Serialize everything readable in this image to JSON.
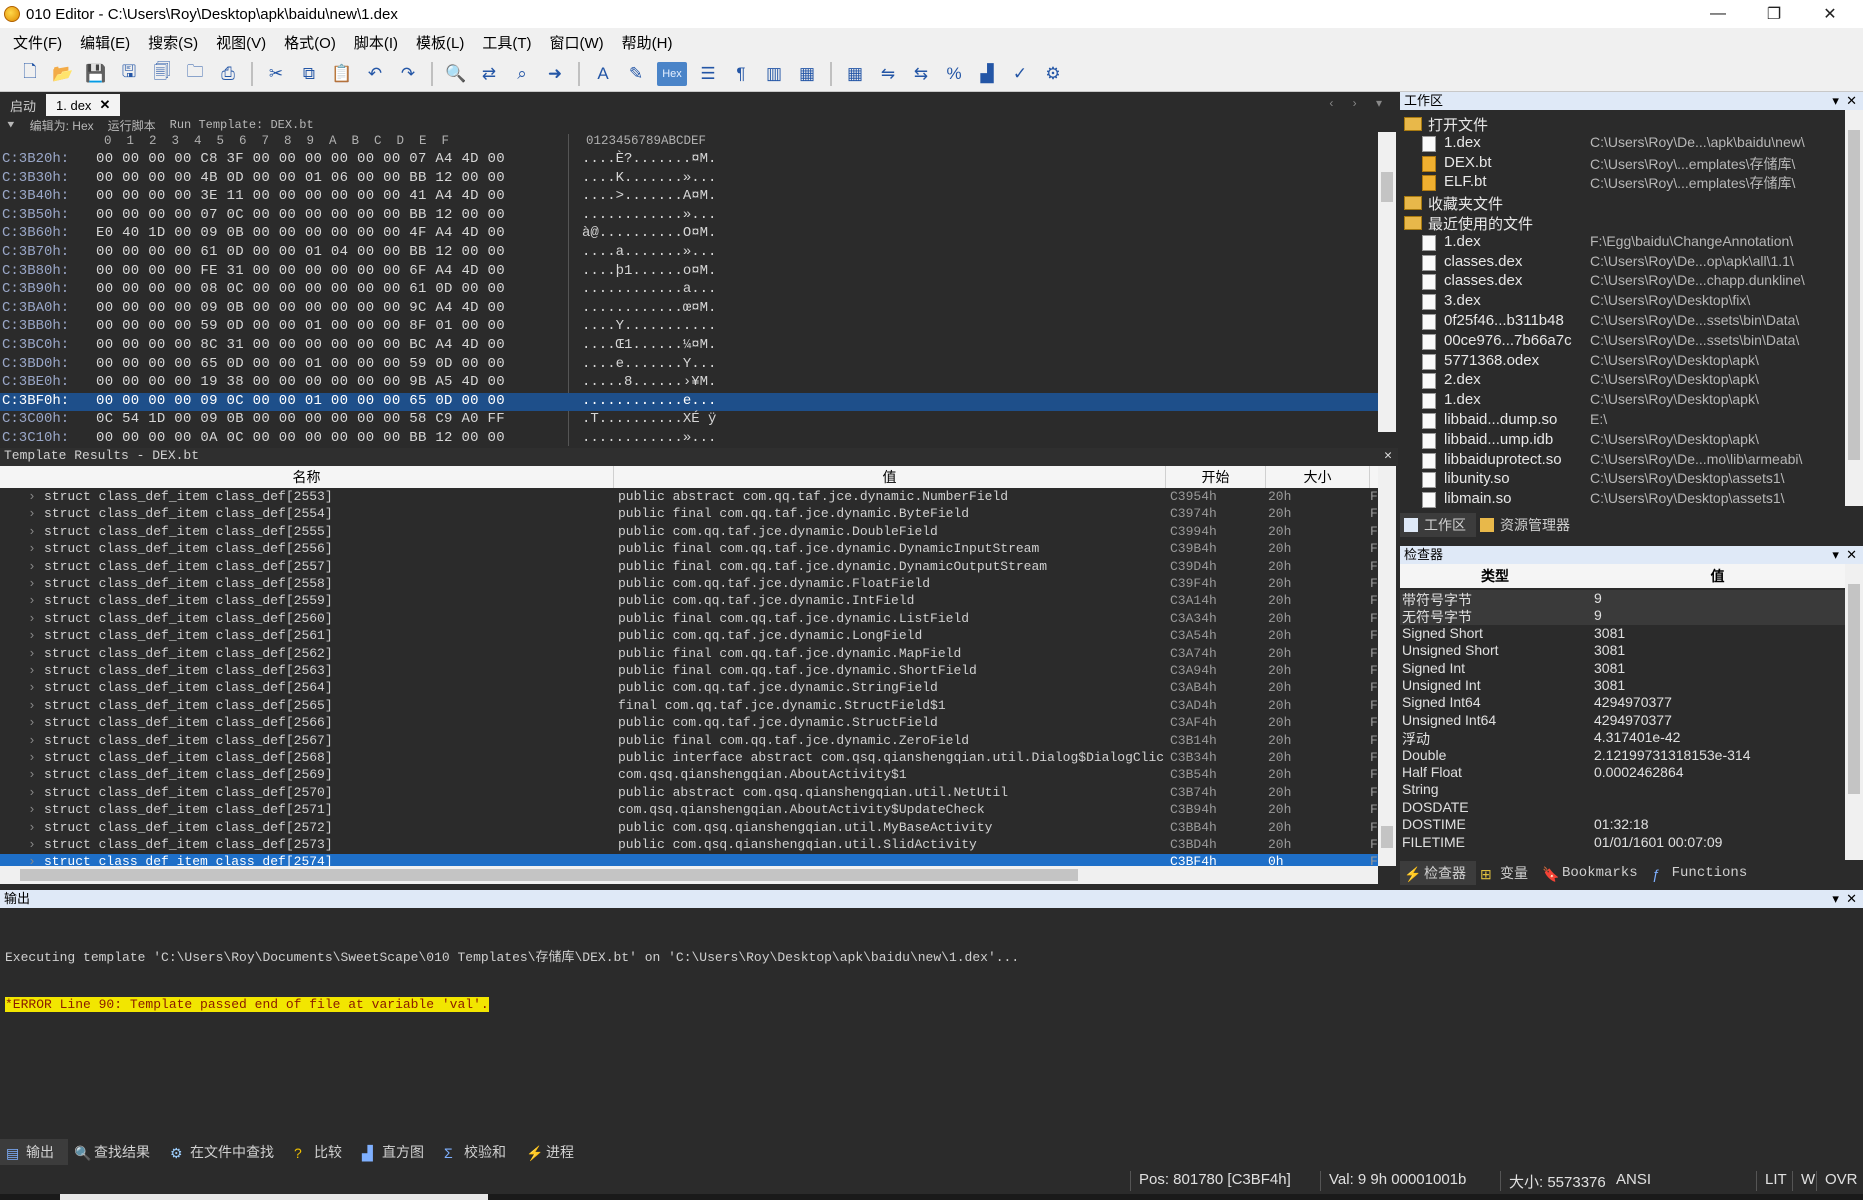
{
  "window": {
    "title": "010 Editor - C:\\Users\\Roy\\Desktop\\apk\\baidu\\new\\1.dex"
  },
  "menu": [
    "文件(F)",
    "编辑(E)",
    "搜索(S)",
    "视图(V)",
    "格式(O)",
    "脚本(I)",
    "模板(L)",
    "工具(T)",
    "窗口(W)",
    "帮助(H)"
  ],
  "tabs": {
    "start": "启动",
    "active": "1. dex"
  },
  "hex": {
    "edit_as": "编辑为: Hex",
    "run_script": "运行脚本",
    "run_template": "Run Template: DEX.bt",
    "col_header": "0  1  2  3  4  5  6  7  8  9  A  B  C  D  E  F",
    "ascii_header": "0123456789ABCDEF",
    "rows": [
      {
        "addr": "C:3B20h:",
        "bytes": "00 00 00 00 C8 3F 00 00 00 00 00 00 07 A4 4D 00",
        "ascii": "....È?.......¤M."
      },
      {
        "addr": "C:3B30h:",
        "bytes": "00 00 00 00 4B 0D 00 00 01 06 00 00 BB 12 00 00",
        "ascii": "....K.......»..."
      },
      {
        "addr": "C:3B40h:",
        "bytes": "00 00 00 00 3E 11 00 00 00 00 00 00 41 A4 4D 00",
        "ascii": "....>.......A¤M."
      },
      {
        "addr": "C:3B50h:",
        "bytes": "00 00 00 00 07 0C 00 00 00 00 00 00 BB 12 00 00",
        "ascii": "............»..."
      },
      {
        "addr": "C:3B60h:",
        "bytes": "E0 40 1D 00 09 0B 00 00 00 00 00 00 4F A4 4D 00",
        "ascii": "à@..........O¤M."
      },
      {
        "addr": "C:3B70h:",
        "bytes": "00 00 00 00 61 0D 00 00 01 04 00 00 BB 12 00 00",
        "ascii": "....a.......»..."
      },
      {
        "addr": "C:3B80h:",
        "bytes": "00 00 00 00 FE 31 00 00 00 00 00 00 6F A4 4D 00",
        "ascii": "....þ1......o¤M."
      },
      {
        "addr": "C:3B90h:",
        "bytes": "00 00 00 00 08 0C 00 00 00 00 00 00 61 0D 00 00",
        "ascii": "............a..."
      },
      {
        "addr": "C:3BA0h:",
        "bytes": "00 00 00 00 09 0B 00 00 00 00 00 00 9C A4 4D 00",
        "ascii": "............œ¤M."
      },
      {
        "addr": "C:3BB0h:",
        "bytes": "00 00 00 00 59 0D 00 00 01 00 00 00 8F 01 00 00",
        "ascii": "....Y..........."
      },
      {
        "addr": "C:3BC0h:",
        "bytes": "00 00 00 00 8C 31 00 00 00 00 00 00 BC A4 4D 00",
        "ascii": "....Œ1......¼¤M."
      },
      {
        "addr": "C:3BD0h:",
        "bytes": "00 00 00 00 65 0D 00 00 01 00 00 00 59 0D 00 00",
        "ascii": "....e.......Y..."
      },
      {
        "addr": "C:3BE0h:",
        "bytes": "00 00 00 00 19 38 00 00 00 00 00 00 9B A5 4D 00",
        "ascii": ".....8......›¥M."
      },
      {
        "addr": "C:3BF0h:",
        "bytes": "00 00 00 00 09 0C 00 00 01 00 00 00 65 0D 00 00",
        "ascii": "............e..."
      },
      {
        "addr": "C:3C00h:",
        "bytes": "0C 54 1D 00 09 0B 00 00 00 00 00 00 58 C9 A0 FF",
        "ascii": ".T..........XÉ ÿ"
      },
      {
        "addr": "C:3C10h:",
        "bytes": "00 00 00 00 0A 0C 00 00 00 00 00 00 BB 12 00 00",
        "ascii": "............»..."
      }
    ]
  },
  "template": {
    "title": "Template Results - DEX.bt",
    "columns": {
      "name": "名称",
      "value": "值",
      "start": "开始",
      "size": "大小"
    },
    "rows": [
      {
        "name": "struct class_def_item class_def[2553]",
        "value": "public abstract com.qq.taf.jce.dynamic.NumberField",
        "start": "C3954h",
        "size": "20h"
      },
      {
        "name": "struct class_def_item class_def[2554]",
        "value": "public final com.qq.taf.jce.dynamic.ByteField",
        "start": "C3974h",
        "size": "20h"
      },
      {
        "name": "struct class_def_item class_def[2555]",
        "value": "public com.qq.taf.jce.dynamic.DoubleField",
        "start": "C3994h",
        "size": "20h"
      },
      {
        "name": "struct class_def_item class_def[2556]",
        "value": "public final com.qq.taf.jce.dynamic.DynamicInputStream",
        "start": "C39B4h",
        "size": "20h"
      },
      {
        "name": "struct class_def_item class_def[2557]",
        "value": "public final com.qq.taf.jce.dynamic.DynamicOutputStream",
        "start": "C39D4h",
        "size": "20h"
      },
      {
        "name": "struct class_def_item class_def[2558]",
        "value": "public com.qq.taf.jce.dynamic.FloatField",
        "start": "C39F4h",
        "size": "20h"
      },
      {
        "name": "struct class_def_item class_def[2559]",
        "value": "public com.qq.taf.jce.dynamic.IntField",
        "start": "C3A14h",
        "size": "20h"
      },
      {
        "name": "struct class_def_item class_def[2560]",
        "value": "public final com.qq.taf.jce.dynamic.ListField",
        "start": "C3A34h",
        "size": "20h"
      },
      {
        "name": "struct class_def_item class_def[2561]",
        "value": "public com.qq.taf.jce.dynamic.LongField",
        "start": "C3A54h",
        "size": "20h"
      },
      {
        "name": "struct class_def_item class_def[2562]",
        "value": "public final com.qq.taf.jce.dynamic.MapField",
        "start": "C3A74h",
        "size": "20h"
      },
      {
        "name": "struct class_def_item class_def[2563]",
        "value": "public final com.qq.taf.jce.dynamic.ShortField",
        "start": "C3A94h",
        "size": "20h"
      },
      {
        "name": "struct class_def_item class_def[2564]",
        "value": "public com.qq.taf.jce.dynamic.StringField",
        "start": "C3AB4h",
        "size": "20h"
      },
      {
        "name": "struct class_def_item class_def[2565]",
        "value": "final com.qq.taf.jce.dynamic.StructField$1",
        "start": "C3AD4h",
        "size": "20h"
      },
      {
        "name": "struct class_def_item class_def[2566]",
        "value": "public com.qq.taf.jce.dynamic.StructField",
        "start": "C3AF4h",
        "size": "20h"
      },
      {
        "name": "struct class_def_item class_def[2567]",
        "value": "public final com.qq.taf.jce.dynamic.ZeroField",
        "start": "C3B14h",
        "size": "20h"
      },
      {
        "name": "struct class_def_item class_def[2568]",
        "value": "public interface abstract com.qsq.qianshengqian.util.Dialog$DialogClick…",
        "start": "C3B34h",
        "size": "20h"
      },
      {
        "name": "struct class_def_item class_def[2569]",
        "value": "com.qsq.qianshengqian.AboutActivity$1",
        "start": "C3B54h",
        "size": "20h"
      },
      {
        "name": "struct class_def_item class_def[2570]",
        "value": "public abstract com.qsq.qianshengqian.util.NetUtil",
        "start": "C3B74h",
        "size": "20h"
      },
      {
        "name": "struct class_def_item class_def[2571]",
        "value": "com.qsq.qianshengqian.AboutActivity$UpdateCheck",
        "start": "C3B94h",
        "size": "20h"
      },
      {
        "name": "struct class_def_item class_def[2572]",
        "value": "public com.qsq.qianshengqian.util.MyBaseActivity",
        "start": "C3BB4h",
        "size": "20h"
      },
      {
        "name": "struct class_def_item class_def[2573]",
        "value": "public com.qsq.qianshengqian.util.SlidActivity",
        "start": "C3BD4h",
        "size": "20h"
      },
      {
        "name": "struct class_def_item class_def[2574]",
        "value": "",
        "start": "C3BF4h",
        "size": "0h"
      }
    ]
  },
  "workspace": {
    "title": "工作区",
    "sections": {
      "open": "打开文件",
      "favorites": "收藏夹文件",
      "recent": "最近使用的文件"
    },
    "open_files": [
      {
        "name": "1.dex",
        "path": "C:\\Users\\Roy\\De...\\apk\\baidu\\new\\",
        "icon": "file"
      },
      {
        "name": "DEX.bt",
        "path": "C:\\Users\\Roy\\...emplates\\存储库\\",
        "icon": "bt"
      },
      {
        "name": "ELF.bt",
        "path": "C:\\Users\\Roy\\...emplates\\存储库\\",
        "icon": "bt"
      }
    ],
    "recent_files": [
      {
        "name": "1.dex",
        "path": "F:\\Egg\\baidu\\ChangeAnnotation\\"
      },
      {
        "name": "classes.dex",
        "path": "C:\\Users\\Roy\\De...op\\apk\\all\\1.1\\"
      },
      {
        "name": "classes.dex",
        "path": "C:\\Users\\Roy\\De...chapp.dunkline\\"
      },
      {
        "name": "3.dex",
        "path": "C:\\Users\\Roy\\Desktop\\fix\\"
      },
      {
        "name": "0f25f46...b311b48",
        "path": "C:\\Users\\Roy\\De...ssets\\bin\\Data\\"
      },
      {
        "name": "00ce976...7b66a7c",
        "path": "C:\\Users\\Roy\\De...ssets\\bin\\Data\\"
      },
      {
        "name": "5771368.odex",
        "path": "C:\\Users\\Roy\\Desktop\\apk\\"
      },
      {
        "name": "2.dex",
        "path": "C:\\Users\\Roy\\Desktop\\apk\\"
      },
      {
        "name": "1.dex",
        "path": "C:\\Users\\Roy\\Desktop\\apk\\"
      },
      {
        "name": "libbaid...dump.so",
        "path": "E:\\"
      },
      {
        "name": "libbaid...ump.idb",
        "path": "C:\\Users\\Roy\\Desktop\\apk\\"
      },
      {
        "name": "libbaiduprotect.so",
        "path": "C:\\Users\\Roy\\De...mo\\lib\\armeabi\\"
      },
      {
        "name": "libunity.so",
        "path": "C:\\Users\\Roy\\Desktop\\assets1\\"
      },
      {
        "name": "libmain.so",
        "path": "C:\\Users\\Roy\\Desktop\\assets1\\"
      }
    ],
    "tabs": {
      "workspace": "工作区",
      "explorer": "资源管理器"
    }
  },
  "inspector": {
    "title": "检查器",
    "columns": {
      "type": "类型",
      "value": "值"
    },
    "rows": [
      {
        "k": "带符号字节",
        "v": "9"
      },
      {
        "k": "无符号字节",
        "v": "9"
      },
      {
        "k": "Signed Short",
        "v": "3081"
      },
      {
        "k": "Unsigned Short",
        "v": "3081"
      },
      {
        "k": "Signed Int",
        "v": "3081"
      },
      {
        "k": "Unsigned Int",
        "v": "3081"
      },
      {
        "k": "Signed Int64",
        "v": "4294970377"
      },
      {
        "k": "Unsigned Int64",
        "v": "4294970377"
      },
      {
        "k": "浮动",
        "v": "4.317401e-42"
      },
      {
        "k": "Double",
        "v": "2.12199731318153e-314"
      },
      {
        "k": "Half Float",
        "v": "0.0002462864"
      },
      {
        "k": "String",
        "v": ""
      },
      {
        "k": "DOSDATE",
        "v": ""
      },
      {
        "k": "DOSTIME",
        "v": "01:32:18"
      },
      {
        "k": "FILETIME",
        "v": "01/01/1601 00:07:09"
      }
    ],
    "tabs": {
      "inspector": "检查器",
      "vars": "变量",
      "bookmarks": "Bookmarks",
      "functions": "Functions"
    }
  },
  "output": {
    "title": "输出",
    "line1": "Executing template 'C:\\Users\\Roy\\Documents\\SweetScape\\010 Templates\\存储库\\DEX.bt' on 'C:\\Users\\Roy\\Desktop\\apk\\baidu\\new\\1.dex'...",
    "line2": "*ERROR Line 90: Template passed end of file at variable 'val'.",
    "tabs": [
      "输出",
      "查找结果",
      "在文件中查找",
      "比较",
      "直方图",
      "校验和",
      "进程"
    ]
  },
  "status": {
    "pos": "Pos: 801780 [C3BF4h]",
    "val": "Val: 9 9h 00001001b",
    "size": "大小: 5573376",
    "enc": "ANSI",
    "lit": "LIT",
    "w": "W",
    "ovr": "OVR"
  }
}
